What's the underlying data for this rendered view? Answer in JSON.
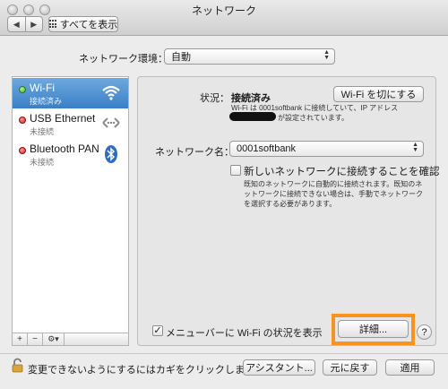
{
  "window": {
    "title": "ネットワーク"
  },
  "toolbar": {
    "show_all_label": "すべてを表示"
  },
  "location": {
    "label": "ネットワーク環境：",
    "value": "自動"
  },
  "services": [
    {
      "name": "Wi-Fi",
      "status": "接続済み",
      "indicator": "green",
      "icon": "wifi-icon"
    },
    {
      "name": "USB Ethernet",
      "status": "未接続",
      "indicator": "red",
      "icon": "ethernet-arrows-icon"
    },
    {
      "name": "Bluetooth PAN",
      "status": "未接続",
      "indicator": "red",
      "icon": "bluetooth-icon"
    }
  ],
  "detail": {
    "status_label": "状況：",
    "status_value": "接続済み",
    "toggle_button": "Wi-Fi を切にする",
    "status_desc_line1": "Wi-Fi は 0001softbank に接続していて、IP アドレス",
    "status_desc_line2": "が設定されています。",
    "network_name_label": "ネットワーク名：",
    "network_name_value": "0001softbank",
    "ask_join_label": "新しいネットワークに接続することを確認",
    "ask_join_desc": "既知のネットワークに自動的に接続されます。既知のネットワークに接続できない場合は、手動でネットワークを選択する必要があります。",
    "show_menu_label": "メニューバーに Wi-Fi の状況を表示",
    "advanced_button": "詳細...",
    "help_label": "?"
  },
  "sidebar_tools": {
    "add": "+",
    "remove": "−",
    "gear": "⚙▾"
  },
  "footer": {
    "lock_text": "変更できないようにするにはカギをクリックします。",
    "assistant_button": "アシスタント...",
    "revert_button": "元に戻す",
    "apply_button": "適用"
  },
  "colors": {
    "selected_row": "#3a7fc6",
    "highlight_box": "#f7931e"
  }
}
